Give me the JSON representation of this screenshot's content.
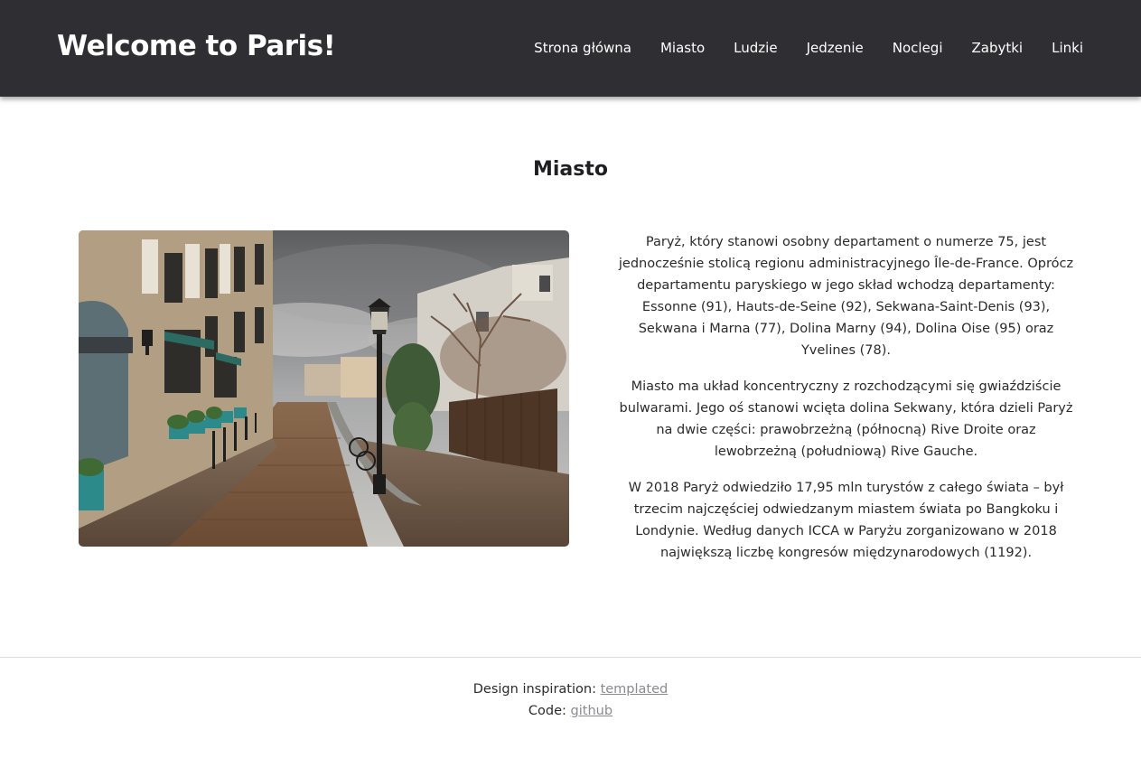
{
  "header": {
    "site_title": "Welcome to Paris!",
    "nav": [
      {
        "label": "Strona główna"
      },
      {
        "label": "Miasto"
      },
      {
        "label": "Ludzie"
      },
      {
        "label": "Jedzenie"
      },
      {
        "label": "Noclegi"
      },
      {
        "label": "Zabytki"
      },
      {
        "label": "Linki"
      }
    ],
    "background_color": "#2f2e33"
  },
  "main": {
    "section_title": "Miasto",
    "image": {
      "icon": "photo-montmartre-street"
    },
    "paragraphs": [
      "Paryż, który stanowi osobny departament o numerze 75, jest jednocześnie stolicą regionu administracyjnego Île-de-France. Oprócz departamentu paryskiego w jego skład wchodzą departamenty: Essonne (91), Hauts-de-Seine (92), Sekwana-Saint-Denis (93), Sekwana i Marna (77), Dolina Marny (94), Dolina Oise (95) oraz Yvelines (78).",
      "Miasto ma układ koncentryczny z rozchodzącymi się gwiaździście bulwarami. Jego oś stanowi wcięta dolina Sekwany, która dzieli Paryż na dwie części: prawobrzeżną (północną) Rive Droite oraz lewobrzeżną (południową) Rive Gauche.",
      "W 2018 Paryż odwiedziło 17,95 mln turystów z całego świata – był trzecim najczęściej odwiedzanym miastem świata po Bangkoku i Londynie. Według danych ICCA w Paryżu zorganizowano w 2018 największą liczbę kongresów międzynarodowych (1192)."
    ]
  },
  "footer": {
    "design_label": "Design inspiration:",
    "design_link": "templated",
    "code_label": "Code:",
    "code_link": "github"
  }
}
